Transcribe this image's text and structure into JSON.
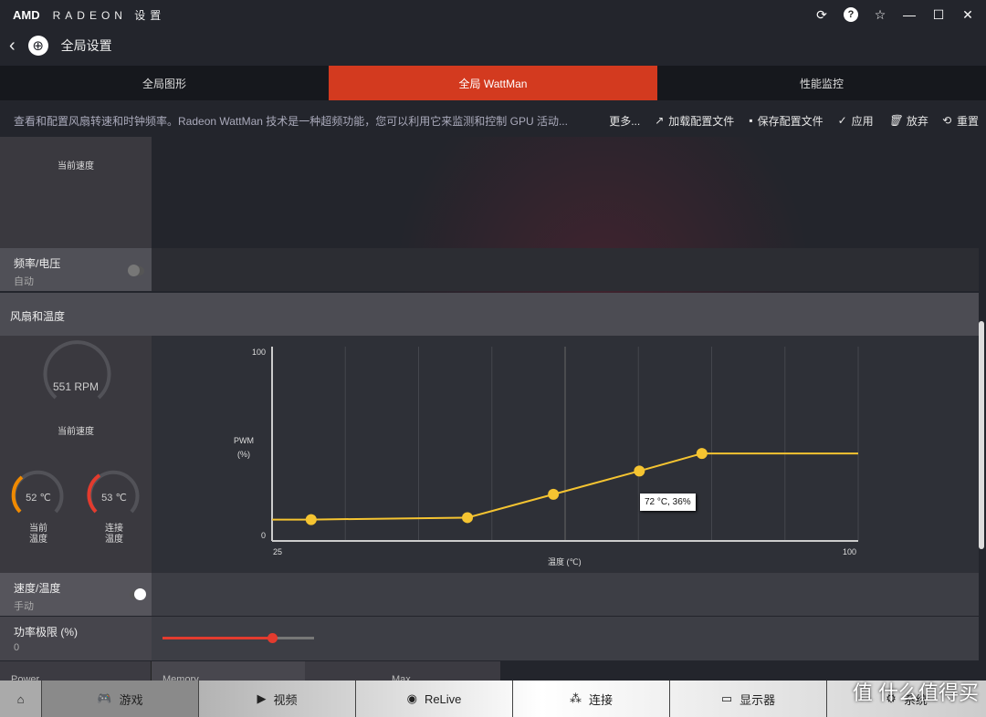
{
  "titlebar": {
    "logo": "AMD",
    "brand": "RADEON 设置",
    "buttons": [
      "refresh-icon",
      "help-icon",
      "star-icon",
      "minimize-icon",
      "maximize-icon",
      "close-icon"
    ]
  },
  "nav": {
    "back": "‹",
    "title": "全局设置"
  },
  "tabs": [
    {
      "label": "全局图形"
    },
    {
      "label": "全局 WattMan",
      "active": true
    },
    {
      "label": "性能监控"
    }
  ],
  "description": "查看和配置风扇转速和时钟频率。Radeon WattMan 技术是一种超频功能，您可以利用它来监测和控制 GPU 活动...",
  "actions": {
    "more": "更多...",
    "load": "加载配置文件",
    "save": "保存配置文件",
    "apply": "应用",
    "discard": "放弃",
    "reset": "重置"
  },
  "upper": {
    "speed_label": "当前速度",
    "freq_label": "频率/电压",
    "freq_mode": "自动",
    "freq_toggle": false
  },
  "fan": {
    "section": "风扇和温度",
    "rpm": "551 RPM",
    "rpm_label": "当前速度",
    "temp1": "52 ℃",
    "temp1_label": "当前\n温度",
    "temp2": "53 ℃",
    "temp2_label": "连接\n温度",
    "speed_temp_label": "速度/温度",
    "speed_temp_mode": "手动",
    "speed_temp_toggle": true,
    "power_label": "功率极限 (%)",
    "power_value": "0",
    "power_slider_fraction": 0.72
  },
  "lower_tabs": [
    "Power",
    "Memory",
    "Max"
  ],
  "chart_data": {
    "type": "line",
    "xlabel": "温度 (℃)",
    "ylabel": "PWM\n(%)",
    "xlim": [
      25,
      100
    ],
    "ylim": [
      0,
      100
    ],
    "xticks": [
      "25",
      "100"
    ],
    "yticks": [
      "100",
      "0"
    ],
    "points": [
      [
        30,
        11
      ],
      [
        50,
        12
      ],
      [
        61,
        24
      ],
      [
        72,
        36
      ],
      [
        80,
        45
      ]
    ],
    "line_end": [
      100,
      45
    ],
    "tooltip": "72 °C, 36%",
    "color": "#f5c431",
    "grid": true
  },
  "bottom": [
    {
      "icon": "home-icon",
      "label": ""
    },
    {
      "icon": "gamepad-icon",
      "label": "游戏"
    },
    {
      "icon": "play-icon",
      "label": "视频"
    },
    {
      "icon": "relive-icon",
      "label": "ReLive"
    },
    {
      "icon": "connect-icon",
      "label": "连接"
    },
    {
      "icon": "monitor-icon",
      "label": "显示器"
    },
    {
      "icon": "gear-icon",
      "label": "系统"
    }
  ],
  "watermark": "值 什么值得买",
  "colors": {
    "accent": "#d33a1f",
    "curve": "#f5c431",
    "temp1": "#f08a00",
    "temp2": "#e33b2e"
  }
}
